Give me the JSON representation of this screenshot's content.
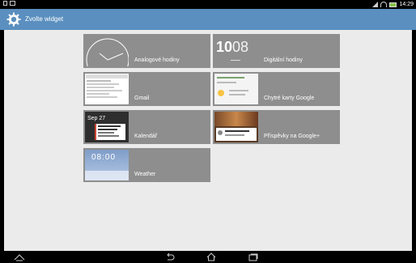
{
  "status_bar": {
    "time": "14:29",
    "left_icons": [
      "screenshot-icon",
      "notification-icon"
    ],
    "right_icons": [
      "signal-icon",
      "wifi-icon",
      "battery-icon"
    ]
  },
  "header": {
    "title": "Zvolte widget",
    "icon": "gear-icon"
  },
  "widgets": [
    {
      "id": "analog",
      "label": "Analogové hodiny"
    },
    {
      "id": "digital",
      "label": "Digitální hodiny",
      "preview_time_h": "10",
      "preview_time_m": "08"
    },
    {
      "id": "gmail",
      "label": "Gmail"
    },
    {
      "id": "google-now",
      "label": "Chytré karty Google"
    },
    {
      "id": "calendar",
      "label": "Kalendář",
      "preview_date": "Sep 27"
    },
    {
      "id": "google-plus",
      "label": "Příspěvky na Google+"
    },
    {
      "id": "weather",
      "label": "Weather",
      "preview_time": "08:00"
    }
  ],
  "nav": {
    "buttons": [
      "asus-up-icon",
      "back-icon",
      "home-icon",
      "recents-icon"
    ]
  }
}
